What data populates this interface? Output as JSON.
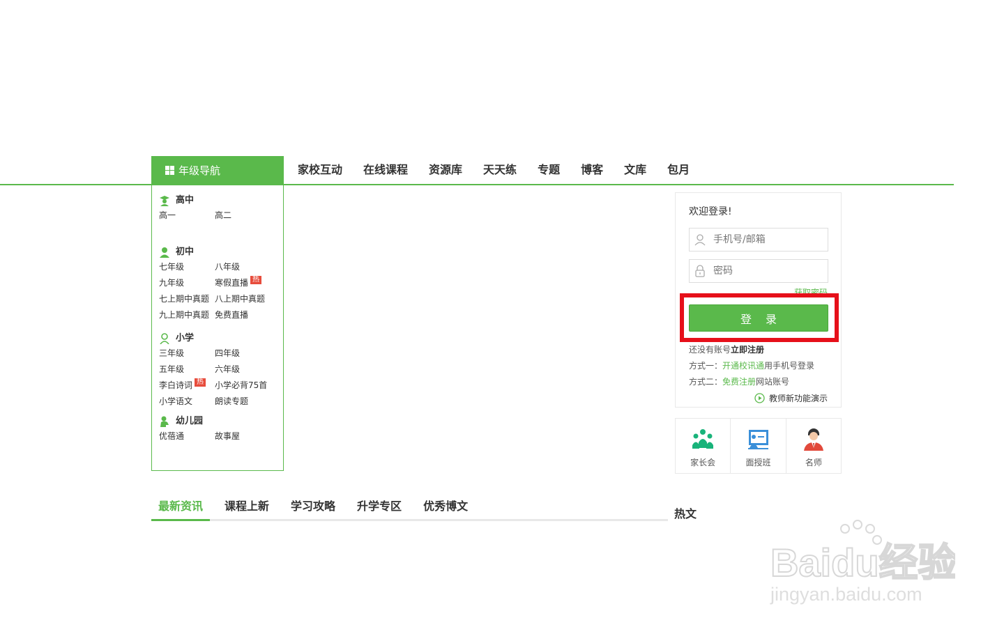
{
  "colors": {
    "accent": "#5ab94b",
    "highlight": "#e6101a",
    "hot": "#e74c3c"
  },
  "grade_nav": {
    "label": "年级导航",
    "icon": "grid-icon"
  },
  "main_nav": [
    "家校互动",
    "在线课程",
    "资源库",
    "天天练",
    "专题",
    "博客",
    "文库",
    "包月"
  ],
  "grades": {
    "high": {
      "title": "高中",
      "links": [
        "高一",
        "高二"
      ]
    },
    "middle": {
      "title": "初中",
      "links": [
        "七年级",
        "八年级",
        "九年级",
        "寒假直播",
        "七上期中真题",
        "八上期中真题",
        "九上期中真题",
        "免费直播"
      ],
      "hot_badge": "热"
    },
    "primary": {
      "title": "小学",
      "links": [
        "三年级",
        "四年级",
        "五年级",
        "六年级",
        "李白诗词",
        "小学必背75首",
        "小学语文",
        "朗读专题"
      ],
      "hot_badge": "热"
    },
    "kindergarten": {
      "title": "幼儿园",
      "links": [
        "优蓓通",
        "故事屋"
      ]
    }
  },
  "login": {
    "welcome": "欢迎登录!",
    "phone_placeholder": "手机号/邮箱",
    "password_placeholder": "密码",
    "forgot": "获取密码",
    "button": "登录",
    "no_account_prefix": "还没有账号",
    "register_now": "立即注册",
    "method1_prefix": "方式一：",
    "method1_link": "开通校讯通",
    "method1_suffix": "用手机号登录",
    "method2_prefix": "方式二：",
    "method2_link": "免费注册",
    "method2_suffix": "网站账号",
    "teacher_demo": "教师新功能演示"
  },
  "services": [
    {
      "label": "家长会",
      "icon": "parent-meeting-icon"
    },
    {
      "label": "面授班",
      "icon": "classroom-icon"
    },
    {
      "label": "名师",
      "icon": "teacher-icon"
    }
  ],
  "news_tabs": [
    "最新资讯",
    "课程上新",
    "学习攻略",
    "升学专区",
    "优秀博文"
  ],
  "hot_title": "热文",
  "watermark": {
    "logo": "Baidu经验",
    "url": "jingyan.baidu.com"
  }
}
